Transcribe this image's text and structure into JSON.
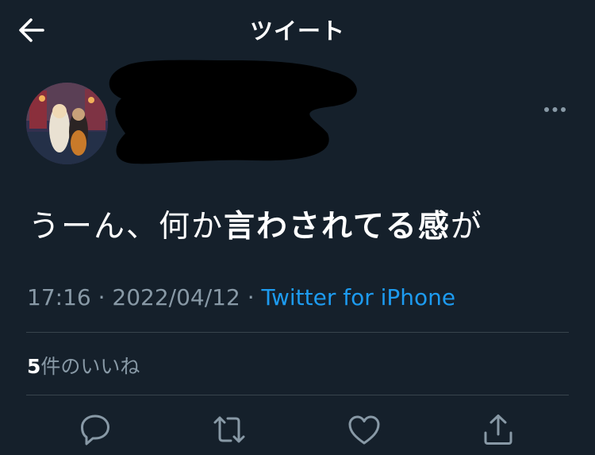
{
  "header": {
    "title": "ツイート",
    "back_icon": "arrow-left-icon"
  },
  "tweet": {
    "author_name": "",
    "text_parts": [
      {
        "text": "うーん、何か",
        "bold": false
      },
      {
        "text": "言わされてる感",
        "bold": true
      },
      {
        "text": "が",
        "bold": false
      }
    ],
    "time": "17:16",
    "separator1": " · ",
    "date": "2022/04/12",
    "separator2": " · ",
    "source": "Twitter for iPhone"
  },
  "engagement": {
    "likes_count": "5",
    "likes_label": "件のいいね"
  },
  "actions": {
    "reply_icon": "reply-icon",
    "retweet_icon": "retweet-icon",
    "like_icon": "heart-icon",
    "share_icon": "share-icon"
  },
  "colors": {
    "background": "#15202b",
    "text_primary": "#ffffff",
    "text_secondary": "#8899a6",
    "link": "#1d9bf0",
    "divider": "#38444d"
  }
}
